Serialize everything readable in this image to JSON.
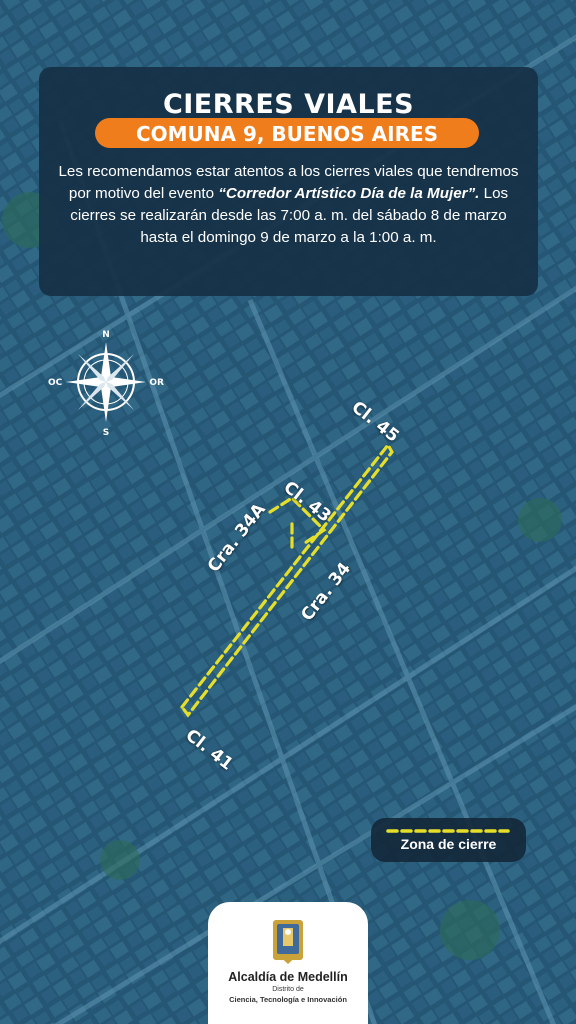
{
  "header": {
    "title": "CIERRES VIALES",
    "subtitle": "COMUNA 9, BUENOS AIRES",
    "intro": "Les recomendamos estar atentos a los cierres viales que tendremos por motivo del evento",
    "event_name": "“Corredor Artístico Día de la Mujer”.",
    "details": "Los cierres se realizarán desde las 7:00 a. m. del sábado 8 de marzo hasta el domingo 9 de marzo a la 1:00 a. m."
  },
  "compass": {
    "north": "N",
    "south": "S",
    "east": "OR",
    "west": "OC"
  },
  "streets": {
    "cl45": "Cl. 45",
    "cl43": "Cl. 43",
    "cra34a": "Cra. 34A",
    "cra34": "Cra. 34",
    "cl41": "Cl. 41"
  },
  "legend": {
    "label": "Zona de cierre"
  },
  "organization": {
    "name": "Alcaldía de Medellín",
    "subtitle_line1": "Distrito de",
    "subtitle_line2": "Ciencia, Tecnología e Innovación"
  },
  "colors": {
    "closure": "#e6df2a",
    "accent": "#f07d1c",
    "card": "#163046"
  }
}
